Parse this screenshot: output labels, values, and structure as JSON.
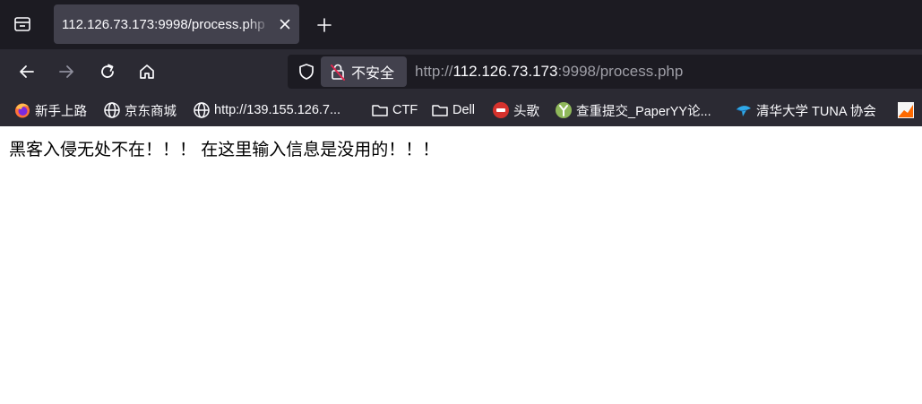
{
  "tab": {
    "title": "112.126.73.173:9998/process.php"
  },
  "urlbar": {
    "insecure_label": "不安全",
    "url_scheme": "http://",
    "url_host": "112.126.73.173",
    "url_rest": ":9998/process.php"
  },
  "bookmarks": [
    {
      "label": "新手上路",
      "icon": "firefox-icon"
    },
    {
      "label": "京东商城",
      "icon": "globe-icon"
    },
    {
      "label": "http://139.155.126.7...",
      "icon": "globe-icon"
    },
    {
      "label": "CTF",
      "icon": "folder-icon"
    },
    {
      "label": "Dell",
      "icon": "folder-icon"
    },
    {
      "label": "头歌",
      "icon": "touge-icon"
    },
    {
      "label": "查重提交_PaperYY论...",
      "icon": "paperyy-icon"
    },
    {
      "label": "清华大学 TUNA 协会",
      "icon": "tuna-icon"
    }
  ],
  "page": {
    "message": "黑客入侵无处不在！！！ 在这里输入信息是没用的！！！"
  },
  "colors": {
    "tabstrip_bg": "#1c1b22",
    "toolbar_bg": "#2b2a33",
    "tab_active_bg": "#42414d",
    "text_light": "#fbfbfe",
    "text_dim": "#9e9ea6"
  }
}
